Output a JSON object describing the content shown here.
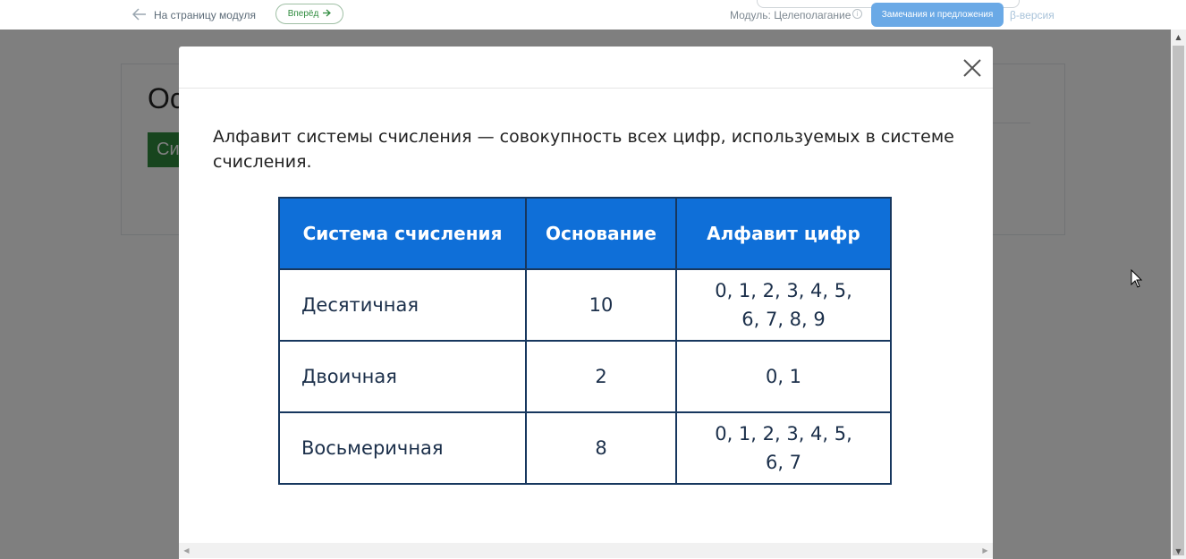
{
  "topbar": {
    "back_label": "На страницу модуля",
    "forward_label": "Вперёд",
    "module_label": "Модуль: Целеполагание",
    "info_symbol": "i",
    "feedback_label": "Замечания и предложения",
    "beta_label": "β-версия"
  },
  "page": {
    "title_fragment": "Ос",
    "green_button_fragment": "Си"
  },
  "modal": {
    "definition": "Алфавит системы счисления — совокупность всех цифр, используемых в системе счисления.",
    "table": {
      "headers": [
        "Система счисления",
        "Основание",
        "Алфавит цифр"
      ],
      "rows": [
        {
          "name": "Десятичная",
          "base": "10",
          "alphabet_line1": "0, 1, 2, 3, 4, 5,",
          "alphabet_line2": "6, 7, 8, 9"
        },
        {
          "name": "Двоичная",
          "base": "2",
          "alphabet_line1": "0, 1",
          "alphabet_line2": ""
        },
        {
          "name": "Восьмеричная",
          "base": "8",
          "alphabet_line1": "0, 1, 2, 3, 4, 5,",
          "alphabet_line2": "6, 7"
        }
      ]
    }
  },
  "icons": {
    "back": "arrow-left-icon",
    "forward": "arrow-right-icon",
    "close": "close-icon",
    "info": "info-icon"
  },
  "colors": {
    "table_header": "#0f6fd8",
    "table_border": "#17375e",
    "feedback_button": "#6aa9e6",
    "forward_text": "#2e8b3d"
  }
}
